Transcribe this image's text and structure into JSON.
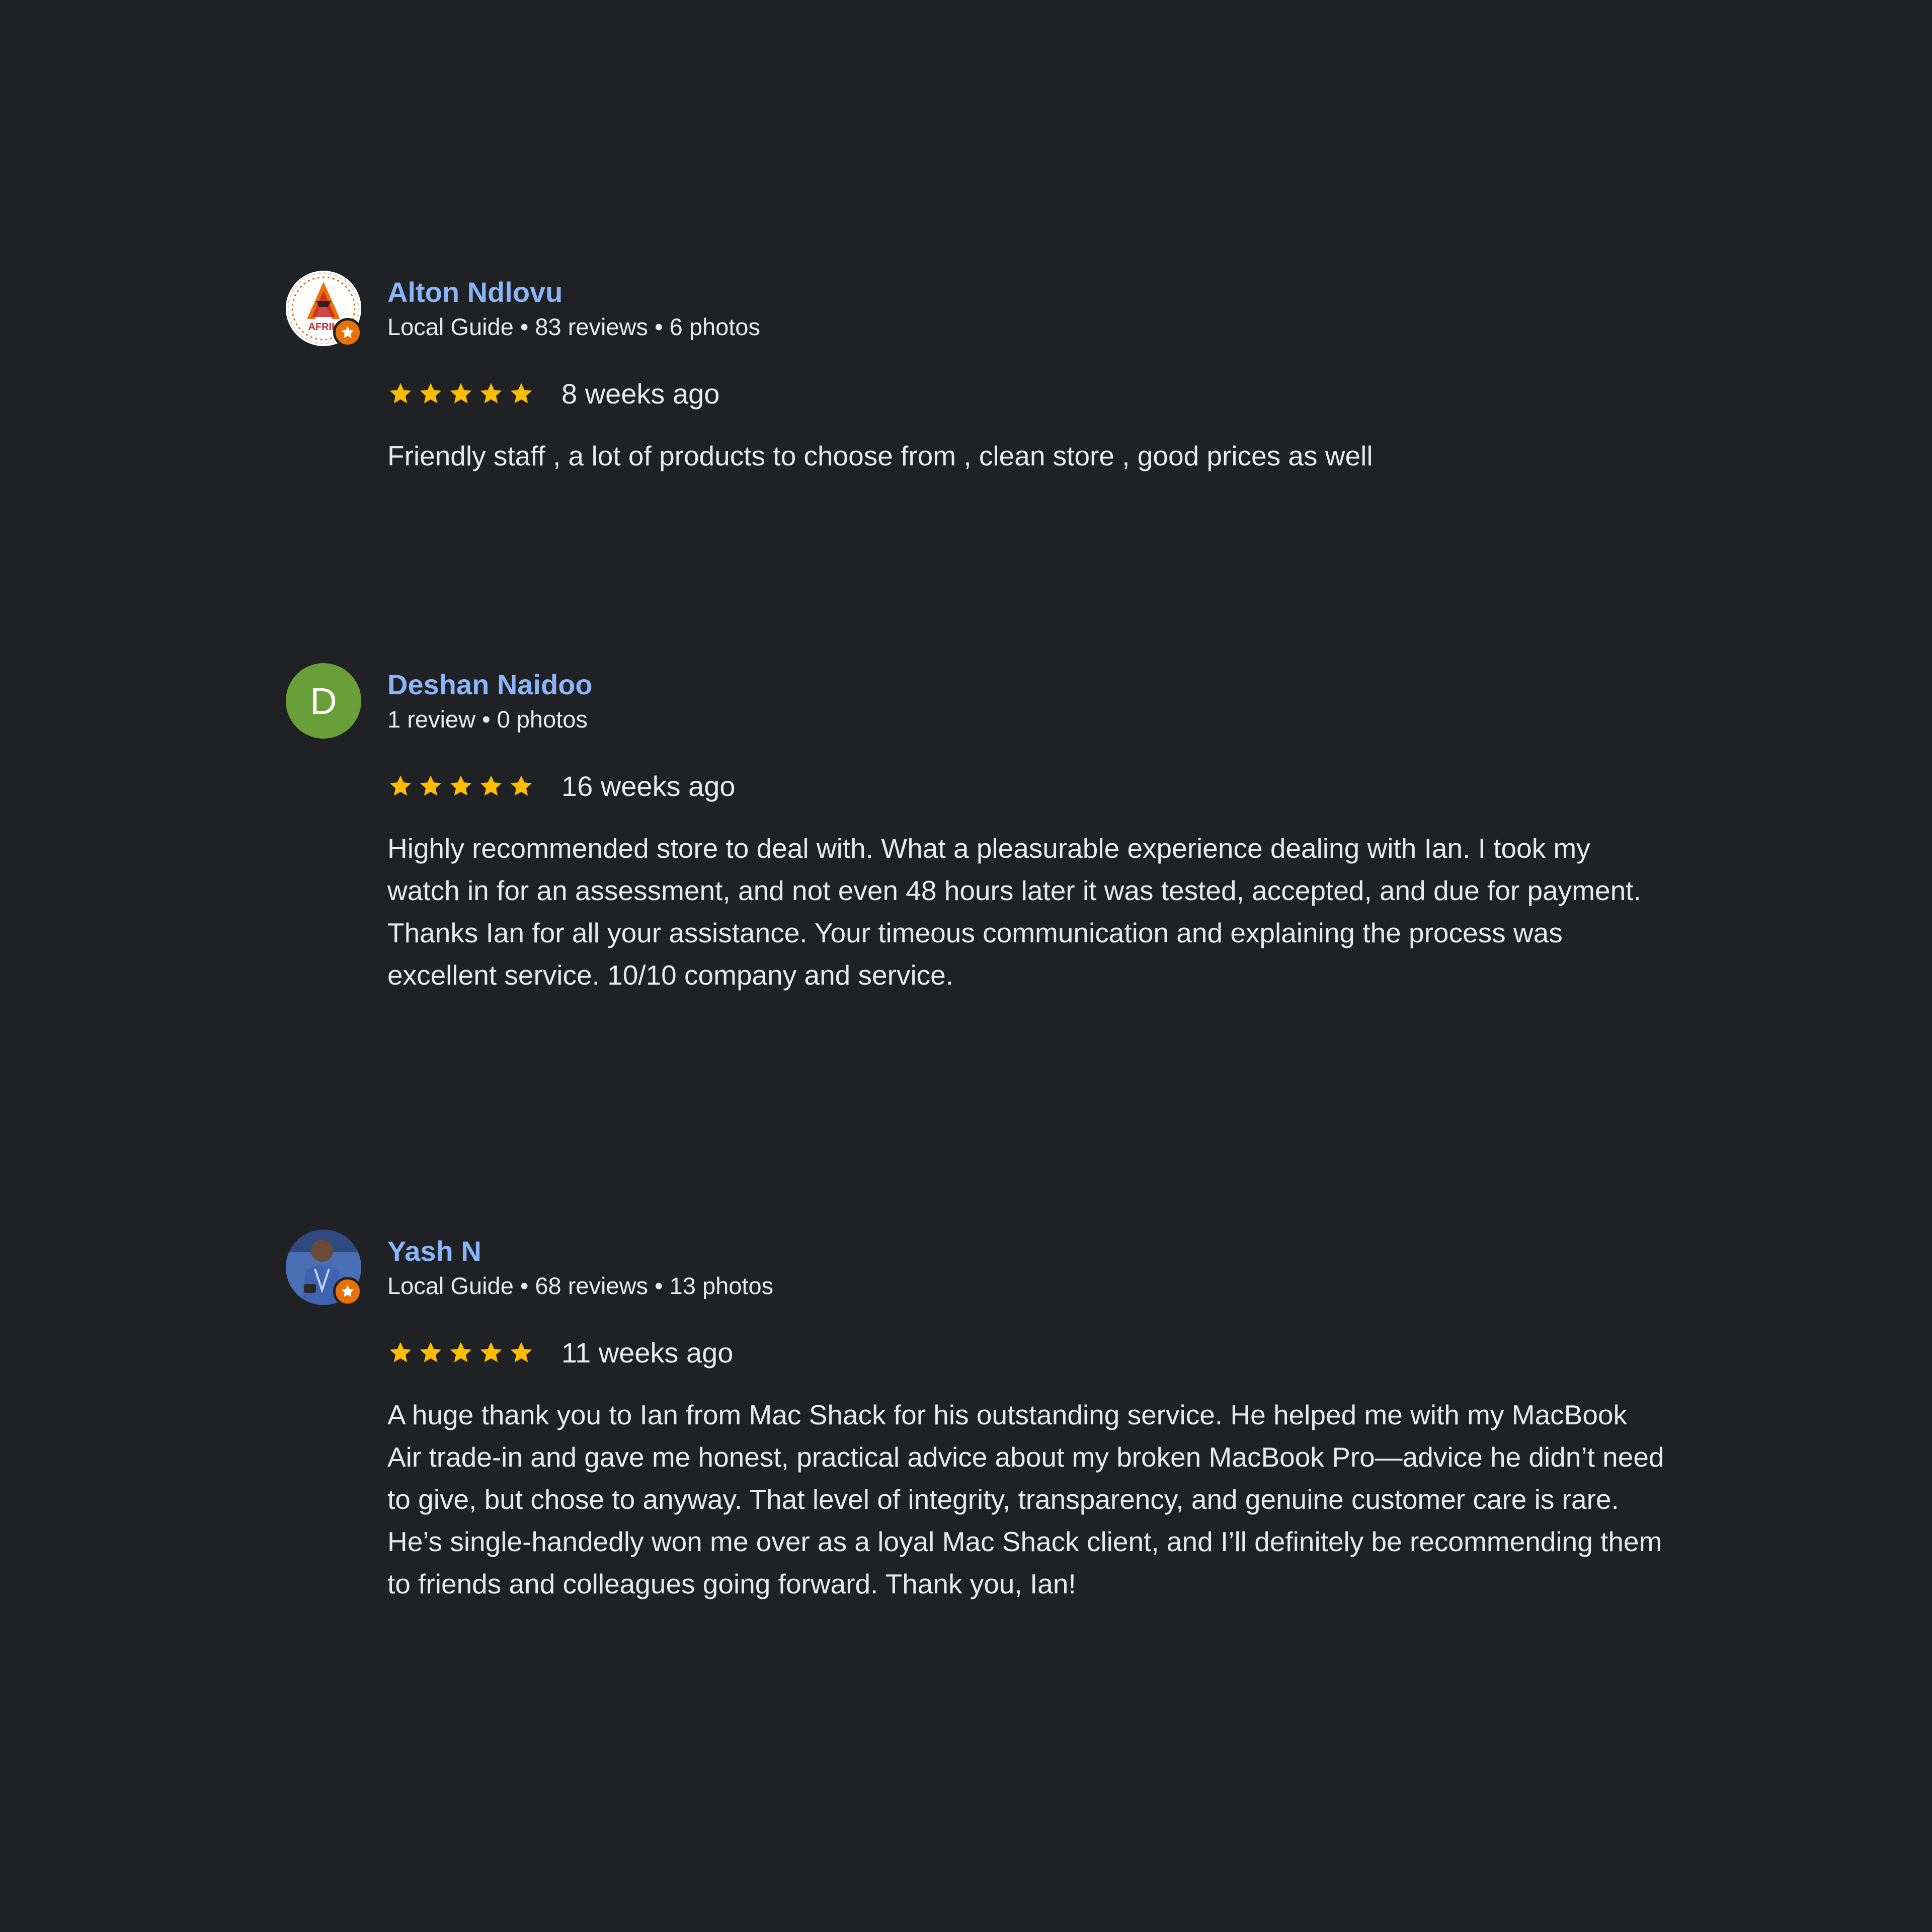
{
  "reviews": [
    {
      "reviewer": "Alton Ndlovu",
      "meta": "Local Guide • 83 reviews • 6 photos",
      "local_guide": true,
      "avatar_kind": "logo",
      "avatar_text": "AFRIK",
      "rating": 5,
      "when": "8 weeks ago",
      "text": "Friendly staff , a lot of products to choose from , clean store , good prices as well"
    },
    {
      "reviewer": "Deshan Naidoo",
      "meta": "1 review • 0 photos",
      "local_guide": false,
      "avatar_kind": "letter",
      "avatar_text": "D",
      "rating": 5,
      "when": "16 weeks ago",
      "text": "Highly recommended store to deal with. What a pleasurable experience dealing with Ian. I took my watch in for an assessment, and not even 48 hours later it was tested, accepted, and due for payment. Thanks Ian for all your assistance. Your timeous communication and explaining the process was excellent service. 10/10 company and service."
    },
    {
      "reviewer": "Yash N",
      "meta": "Local Guide • 68 reviews • 13 photos",
      "local_guide": true,
      "avatar_kind": "photo",
      "rating": 5,
      "when": "11 weeks ago",
      "text": "A huge thank you to Ian from Mac Shack for his outstanding service. He helped me with my MacBook Air trade-in and gave me honest, practical advice about my broken MacBook Pro—advice he didn’t need to give, but chose to anyway. That level of integrity, transparency, and genuine customer care is rare. He’s single-handedly won me over as a loyal Mac Shack client, and I’ll definitely be recommending them to friends and colleagues going forward. Thank you, Ian!"
    }
  ],
  "colors": {
    "background": "#202124",
    "name": "#8ab4f8",
    "star": "#fbbc04",
    "badge": "#e8710a",
    "avatar_letter_bg": "#689f38"
  },
  "icons": {
    "star": "star-icon",
    "local_guide_badge": "local-guide-badge-icon"
  }
}
